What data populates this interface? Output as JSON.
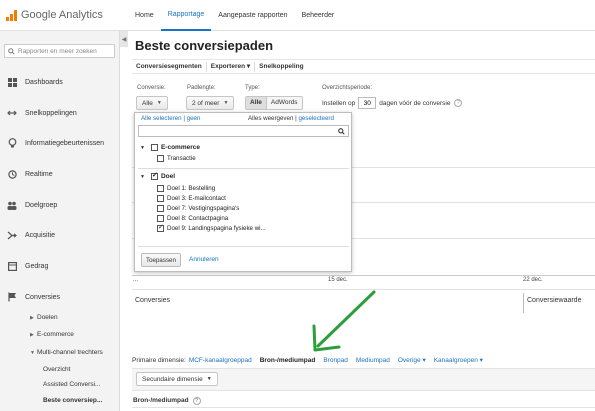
{
  "app": {
    "title": "Google Analytics"
  },
  "topnav": {
    "items": [
      "Home",
      "Rapportage",
      "Aangepaste rapporten",
      "Beheerder"
    ],
    "active": "Rapportage"
  },
  "sidebar": {
    "search_placeholder": "Rapporten en meer zoeken",
    "items": [
      {
        "label": "Dashboards",
        "icon": "grid-icon"
      },
      {
        "label": "Snelkoppelingen",
        "icon": "shortcut-arrows-icon"
      },
      {
        "label": "Informatiegebeurtenissen",
        "icon": "lightbulb-icon"
      },
      {
        "label": "Realtime",
        "icon": "clock-icon"
      },
      {
        "label": "Doelgroep",
        "icon": "people-icon"
      },
      {
        "label": "Acquisitie",
        "icon": "acquisition-icon"
      },
      {
        "label": "Gedrag",
        "icon": "page-icon"
      },
      {
        "label": "Conversies",
        "icon": "flag-icon"
      }
    ],
    "sub_items": [
      "Doelen",
      "E-commerce",
      "Multi-channel trechters"
    ],
    "sub_sub_items": [
      "Overzicht",
      "Assisted Conversi...",
      "Beste conversiep..."
    ]
  },
  "page": {
    "title": "Beste conversiepaden",
    "toolbar": {
      "segments": "Conversiesegmenten",
      "export": "Exporteren",
      "export_caret": "▾",
      "shortcut": "Snelkoppeling"
    },
    "filters": {
      "conversion_label": "Conversie:",
      "conversion_value": "Alle",
      "path_length_label": "Padlengte:",
      "path_length_value": "2 of meer",
      "type_label": "Type:",
      "type_options": [
        "Alle",
        "AdWords"
      ],
      "period_label": "Overzichtsperiode:",
      "period_prefix": "Instellen op",
      "period_days": "30",
      "period_suffix": "dagen vóór de conversie",
      "help": "?"
    },
    "chart": {
      "date_ticks": [
        "...",
        "15 dec.",
        "22 dec."
      ]
    },
    "metrics": {
      "left": "Conversies",
      "right": "Conversiewaarde"
    },
    "dimension": {
      "label": "Primaire dimensie:",
      "options": [
        "MCF-kanaalgroeppad",
        "Bron-/mediumpad",
        "Bronpad",
        "Mediumpad",
        "Overige",
        "Kanaalgroepen"
      ],
      "caret": "▾",
      "selected": "Bron-/mediumpad"
    },
    "secondary_dimension": "Secundaire dimensie",
    "column_header": "Bron-/mediumpad",
    "column_help": "?"
  },
  "popup": {
    "select_all": "Alle selecteren",
    "none": "geen",
    "show_all": "Alles weergeven",
    "selected_link": "geselecteerd",
    "groups": [
      {
        "label": "E-commerce",
        "checked": false,
        "options": [
          {
            "label": "Transactie",
            "checked": false
          }
        ]
      },
      {
        "label": "Doel",
        "checked": true,
        "options": [
          {
            "label": "Doel 1: Bestelling",
            "checked": false
          },
          {
            "label": "Doel 3: E-mailcontact",
            "checked": false
          },
          {
            "label": "Doel 7: Vestigingspagina's",
            "checked": false
          },
          {
            "label": "Doel 8: Contactpagina",
            "checked": false
          },
          {
            "label": "Doel 9: Landingspagina fysieke wi...",
            "checked": true
          }
        ]
      }
    ],
    "apply": "Toepassen",
    "cancel": "Annuleren"
  },
  "colors": {
    "accent": "#1a73c4",
    "arrow": "#2e9e3a",
    "logo": "#f57c00"
  }
}
